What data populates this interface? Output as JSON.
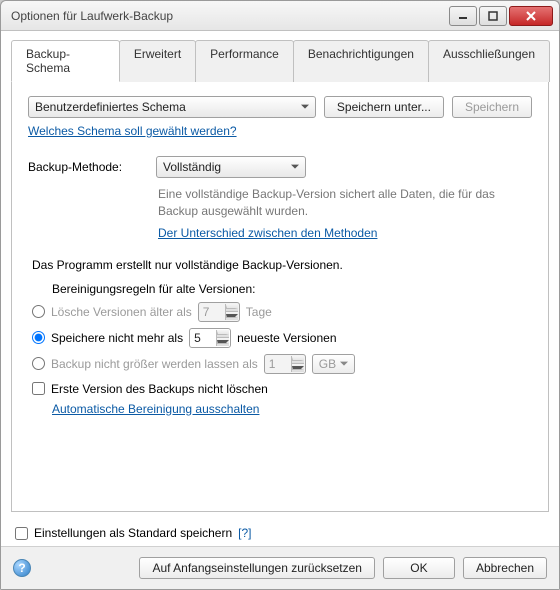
{
  "window": {
    "title": "Optionen für Laufwerk-Backup"
  },
  "tabs": {
    "schema": "Backup-Schema",
    "advanced": "Erweitert",
    "performance": "Performance",
    "notify": "Benachrichtigungen",
    "exclude": "Ausschließungen"
  },
  "schema_row": {
    "selected": "Benutzerdefiniertes Schema",
    "save_as": "Speichern unter...",
    "save": "Speichern",
    "help_link": "Welches Schema soll gewählt werden?"
  },
  "method": {
    "label": "Backup-Methode:",
    "selected": "Vollständig",
    "desc": "Eine vollständige Backup-Version sichert alle Daten, die für das Backup ausgewählt wurden.",
    "diff_link": "Der Unterschied zwischen den Methoden"
  },
  "body": {
    "heading": "Das Programm erstellt nur vollständige Backup-Versionen.",
    "rules_label": "Bereinigungsregeln für alte Versionen:"
  },
  "rules": {
    "older": {
      "label_pre": "Lösche Versionen älter als",
      "value": "7",
      "label_post": "Tage"
    },
    "keep": {
      "label_pre": "Speichere nicht mehr als",
      "value": "5",
      "label_post": "neueste Versionen"
    },
    "size": {
      "label_pre": "Backup nicht größer werden lassen als",
      "value": "1",
      "unit": "GB"
    },
    "first": "Erste Version des Backups nicht löschen",
    "auto_off_link": "Automatische Bereinigung ausschalten"
  },
  "footer": {
    "save_default": "Einstellungen als Standard speichern",
    "qmark": "[?]"
  },
  "buttons": {
    "reset": "Auf Anfangseinstellungen zurücksetzen",
    "ok": "OK",
    "cancel": "Abbrechen"
  }
}
